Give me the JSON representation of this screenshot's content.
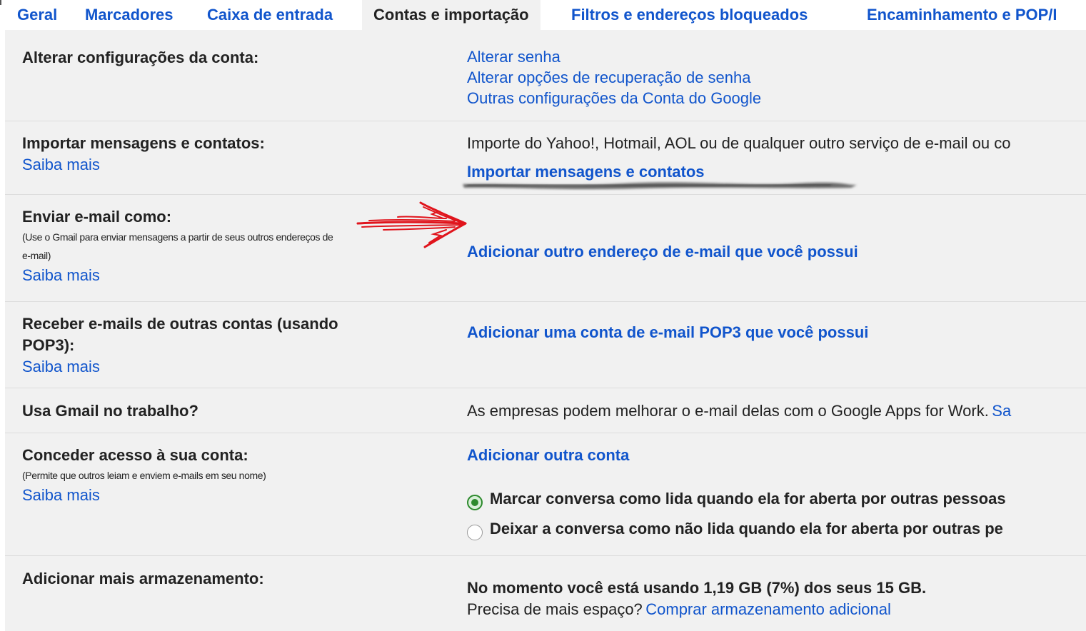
{
  "tabs": [
    {
      "label": "Geral",
      "active": false
    },
    {
      "label": "Marcadores",
      "active": false
    },
    {
      "label": "Caixa de entrada",
      "active": false
    },
    {
      "label": "Contas e importação",
      "active": true
    },
    {
      "label": "Filtros e endereços bloqueados",
      "active": false
    },
    {
      "label": "Encaminhamento e POP/I",
      "active": false
    }
  ],
  "account_settings": {
    "label": "Alterar configurações da conta:",
    "links": [
      "Alterar senha",
      "Alterar opções de recuperação de senha",
      "Outras configurações da Conta do Google"
    ]
  },
  "import": {
    "label": "Importar mensagens e contatos:",
    "learn_more": "Saiba mais",
    "description": "Importe do Yahoo!, Hotmail, AOL ou de qualquer outro serviço de e-mail ou co",
    "action": "Importar mensagens e contatos"
  },
  "send_as": {
    "label": "Enviar e-mail como:",
    "note_line1": "(Use o Gmail para enviar mensagens a partir de seus outros endereços de",
    "note_line2": "e-mail)",
    "learn_more": "Saiba mais",
    "action": "Adicionar outro endereço de e-mail que você possui"
  },
  "pop3": {
    "label": "Receber e-mails de outras contas (usando POP3):",
    "learn_more": "Saiba mais",
    "action": "Adicionar uma conta de e-mail POP3 que você possui"
  },
  "work": {
    "label": "Usa Gmail no trabalho?",
    "description": "As empresas podem melhorar o e-mail delas com o Google Apps for Work.",
    "link": "Sa"
  },
  "grant_access": {
    "label": "Conceder acesso à sua conta:",
    "note": "(Permite que outros leiam e enviem e-mails em seu nome)",
    "learn_more": "Saiba mais",
    "action": "Adicionar outra conta",
    "options": [
      {
        "label": "Marcar conversa como lida quando ela for aberta por outras pessoas",
        "checked": true
      },
      {
        "label": "Deixar a conversa como não lida quando ela for aberta por outras pe",
        "checked": false
      }
    ]
  },
  "storage": {
    "label": "Adicionar mais armazenamento:",
    "usage": "No momento você está usando 1,19 GB (7%) dos seus 15 GB.",
    "question": "Precisa de mais espaço?",
    "action": "Comprar armazenamento adicional"
  },
  "colors": {
    "link": "#1155cc",
    "text": "#222222",
    "panel": "#f1f1f1",
    "annotation_arrow": "#e0141c",
    "radio_checked": "#2d8a2d"
  }
}
